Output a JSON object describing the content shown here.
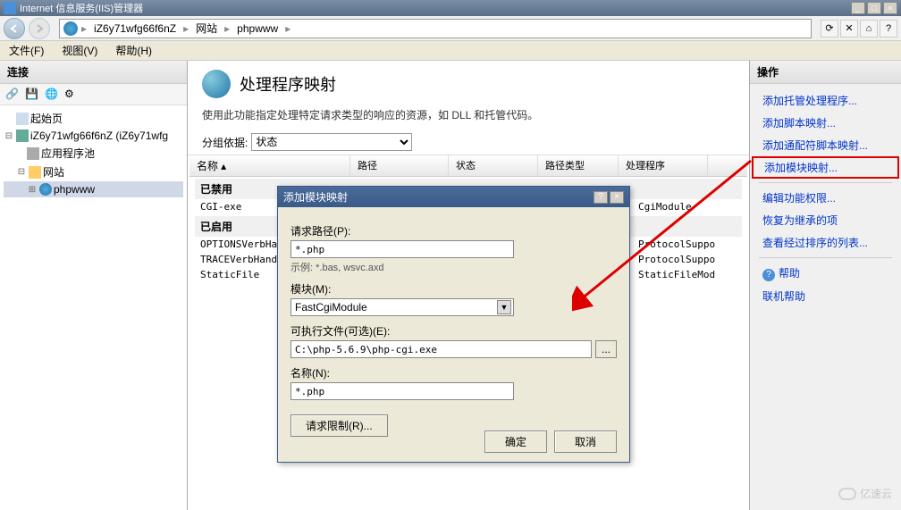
{
  "titlebar": {
    "title": "Internet 信息服务(IIS)管理器"
  },
  "breadcrumb": {
    "items": [
      "iZ6y71wfg66f6nZ",
      "网站",
      "phpwww"
    ]
  },
  "menubar": {
    "file": "文件(F)",
    "view": "视图(V)",
    "help": "帮助(H)"
  },
  "left_panel": {
    "header": "连接",
    "tree": {
      "start": "起始页",
      "server": "iZ6y71wfg66f6nZ (iZ6y71wfg",
      "app_pool": "应用程序池",
      "sites": "网站",
      "site1": "phpwww"
    }
  },
  "content": {
    "title": "处理程序映射",
    "description": "使用此功能指定处理特定请求类型的响应的资源，如 DLL 和托管代码。",
    "filter_label": "分组依据:",
    "filter_value": "状态",
    "columns": {
      "name": "名称",
      "path": "路径",
      "state": "状态",
      "path_type": "路径类型",
      "handler": "处理程序"
    },
    "group_disabled": "已禁用",
    "group_enabled": "已启用",
    "rows_disabled": [
      {
        "name": "CGI-exe",
        "handler": "CgiModule"
      }
    ],
    "rows_enabled": [
      {
        "name": "OPTIONSVerbHandl",
        "handler": "ProtocolSuppo"
      },
      {
        "name": "TRACEVerbHandle",
        "handler": "ProtocolSuppo"
      },
      {
        "name": "StaticFile",
        "handler": "StaticFileMod"
      }
    ]
  },
  "modal": {
    "title": "添加模块映射",
    "request_path_label": "请求路径(P):",
    "request_path_value": "*.php",
    "example_label": "示例: *.bas, wsvc.axd",
    "module_label": "模块(M):",
    "module_value": "FastCgiModule",
    "executable_label": "可执行文件(可选)(E):",
    "executable_value": "C:\\php-5.6.9\\php-cgi.exe",
    "name_label": "名称(N):",
    "name_value": "*.php",
    "limit_btn": "请求限制(R)...",
    "browse_btn": "...",
    "ok": "确定",
    "cancel": "取消"
  },
  "actions": {
    "header": "操作",
    "items": [
      "添加托管处理程序...",
      "添加脚本映射...",
      "添加通配符脚本映射...",
      "添加模块映射..."
    ],
    "secondary": [
      "编辑功能权限...",
      "恢复为继承的项",
      "查看经过排序的列表..."
    ],
    "help": "帮助",
    "online_help": "联机帮助"
  },
  "watermark": "亿速云"
}
